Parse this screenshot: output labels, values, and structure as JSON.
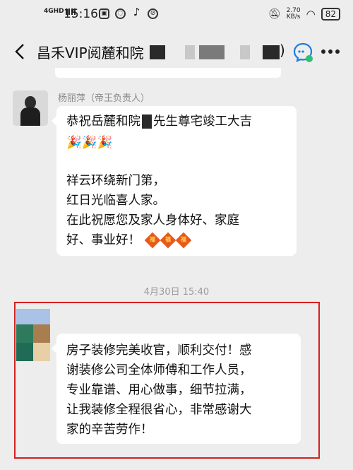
{
  "status_bar": {
    "network": "4GHD",
    "time": "15:16",
    "speed_value": "2.70",
    "speed_unit": "KB/s",
    "battery": "82"
  },
  "header": {
    "title": "昌禾VIP阅麓和院",
    "title_tail": ")",
    "icons": [
      "back-icon",
      "voice-chat-icon",
      "more-icon"
    ]
  },
  "message1": {
    "sender": "杨丽萍（帝王负责人）",
    "line1_a": "恭祝岳麓和院",
    "line1_b": "先生尊宅竣工大吉",
    "line2": "🎉🎉🎉",
    "line3": "祥云环绕新门第，",
    "line4": "红日光临喜人家。",
    "line5": "在此祝愿您及家人身体好、家庭",
    "line6": "好、事业好！",
    "fu_glyph": "福"
  },
  "timestamp": "4月30日 15:40",
  "message2": {
    "line1": "房子装修完美收官，顺利交付！感",
    "line2": "谢装修公司全体师傅和工作人员，",
    "line3": "专业靠谱、用心做事，细节拉满，",
    "line4": "让我装修全程很省心，非常感谢大",
    "line5": "家的辛苦劳作！"
  },
  "colors": {
    "background": "#ededed",
    "bubble": "#ffffff",
    "highlight": "#d42121"
  }
}
